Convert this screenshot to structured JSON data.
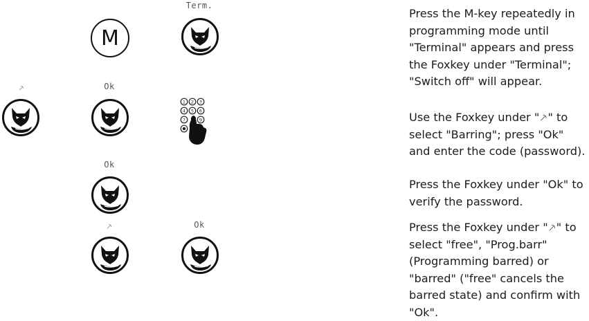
{
  "icons": {
    "foxkey": "foxkey-icon",
    "mkey": "m-key-icon",
    "keypad": "keypad-hand-icon"
  },
  "labels": {
    "term": "Term.",
    "up_arrow": "⸕",
    "ok": "Ok",
    "m_key": "M"
  },
  "steps": [
    {
      "text": "Press the M-key repeatedly in programming mode until \"Terminal\" appears and press the Foxkey under \"Terminal\"; \"Switch off\" will appear."
    },
    {
      "text": "Use the Foxkey under \"⸕\" to select \"Barring\"; press \"Ok\" and enter the code (password)."
    },
    {
      "text": "Press the Foxkey under \"Ok\" to verify the password."
    },
    {
      "text": "Press the Foxkey under \"⸕\" to select \"free\", \"Prog.barr\" (Programming barred) or \"barred\" (\"free\" cancels the barred state) and confirm with \"Ok\"."
    }
  ]
}
